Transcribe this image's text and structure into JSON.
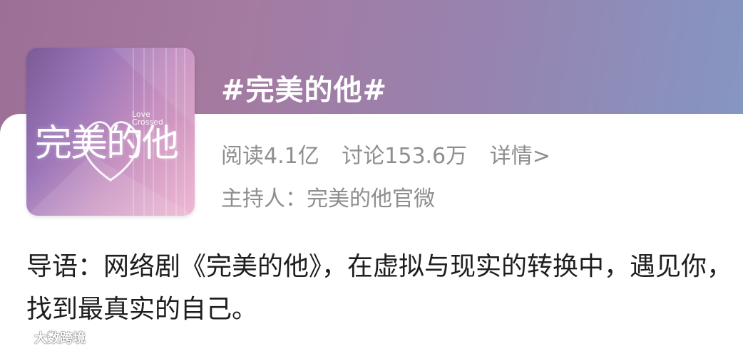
{
  "topic": {
    "title": "#完美的他#",
    "cover": {
      "title": "完美的他",
      "subtitle_line1": "Love",
      "subtitle_line2": "Crossed"
    }
  },
  "stats": {
    "reads": "阅读4.1亿",
    "discussions": "讨论153.6万",
    "detail_link": "详情>"
  },
  "host": {
    "text": "主持人：完美的他官微"
  },
  "intro": {
    "text": "导语：网络剧《完美的他》，在虚拟与现实的转换中，遇见你，找到最真实的自己。"
  },
  "watermark": {
    "text": "大数跨境",
    "icon": "brand-logo-icon"
  },
  "colors": {
    "header_gradient_start": "#9c6f97",
    "header_gradient_end": "#8596c2",
    "meta_text": "#8e8e8e",
    "body_text": "#1e1e1e"
  }
}
